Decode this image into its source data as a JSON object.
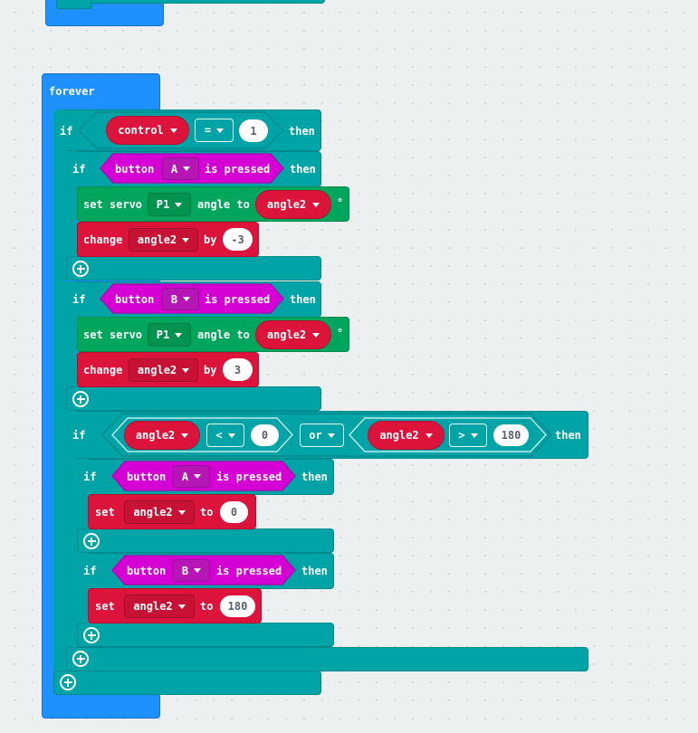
{
  "editor": {
    "canvas_color": "#ecf0f1",
    "colors": {
      "loops": "#1e90ff",
      "logic": "#00a4a6",
      "pins": "#00a65c",
      "variables": "#dc143c",
      "input": "#d400d4"
    }
  },
  "blocks": {
    "forever_label": "forever",
    "if_outer": {
      "keyword": "if",
      "variable": "control",
      "operator": "=",
      "value": "1",
      "then": "then"
    },
    "if_a": {
      "keyword": "if",
      "button_word": "button",
      "button": "A",
      "pressed": "is pressed",
      "then": "then",
      "servo": {
        "set": "set servo",
        "pin": "P1",
        "angle_to": "angle to",
        "variable": "angle2",
        "degree": "°"
      },
      "change": {
        "label": "change",
        "variable": "angle2",
        "by": "by",
        "value": "-3"
      }
    },
    "if_b": {
      "keyword": "if",
      "button_word": "button",
      "button": "B",
      "pressed": "is pressed",
      "then": "then",
      "servo": {
        "set": "set servo",
        "pin": "P1",
        "angle_to": "angle to",
        "variable": "angle2",
        "degree": "°"
      },
      "change": {
        "label": "change",
        "variable": "angle2",
        "by": "by",
        "value": "3"
      }
    },
    "if_range": {
      "keyword": "if",
      "left_var": "angle2",
      "left_op": "<",
      "left_value": "0",
      "logic": "or",
      "right_var": "angle2",
      "right_op": ">",
      "right_value": "180",
      "then": "then",
      "inner_a": {
        "keyword": "if",
        "button_word": "button",
        "button": "A",
        "pressed": "is pressed",
        "then": "then",
        "set": "set",
        "variable": "angle2",
        "to": "to",
        "value": "0"
      },
      "inner_b": {
        "keyword": "if",
        "button_word": "button",
        "button": "B",
        "pressed": "is pressed",
        "then": "then",
        "set": "set",
        "variable": "angle2",
        "to": "to",
        "value": "180"
      }
    }
  }
}
